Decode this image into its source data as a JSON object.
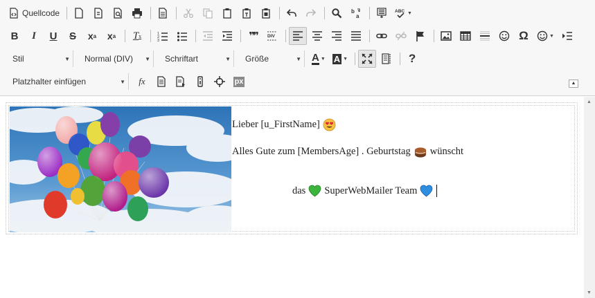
{
  "toolbar": {
    "source_label": "Quellcode",
    "style_combo": "Stil",
    "format_combo": "Normal (DIV)",
    "font_combo": "Schriftart",
    "size_combo": "Größe",
    "placeholder_combo": "Platzhalter einfügen",
    "bold": "B",
    "italic": "I",
    "underline": "U",
    "strike": "S",
    "subscript": "x",
    "subscript_mark": "a",
    "superscript": "x",
    "superscript_mark": "a",
    "remove_format": "T",
    "remove_format_mark": "x",
    "blockquote": "❞❞",
    "creatediv": "DIV",
    "special_char": "Ω",
    "help": "?",
    "function": "fx",
    "px": "px",
    "font_color": "A",
    "bg_color": "A",
    "spellcheck": "ABC",
    "accent_color": "#2b2b2b",
    "bg_color_swatch": "#333333"
  },
  "message": {
    "line1": "Lieber [u_FirstName]",
    "line2": "Alles Gute zum [MembersAge] . Geburtstag",
    "line2_tail": "wünscht",
    "line3_pre": "das",
    "line3_mid": "SuperWebMailer Team",
    "icons": [
      "heart-eyes-emoji-icon",
      "birthday-cake-emoji-icon",
      "green-heart-emoji-icon",
      "blue-heart-emoji-icon"
    ]
  }
}
